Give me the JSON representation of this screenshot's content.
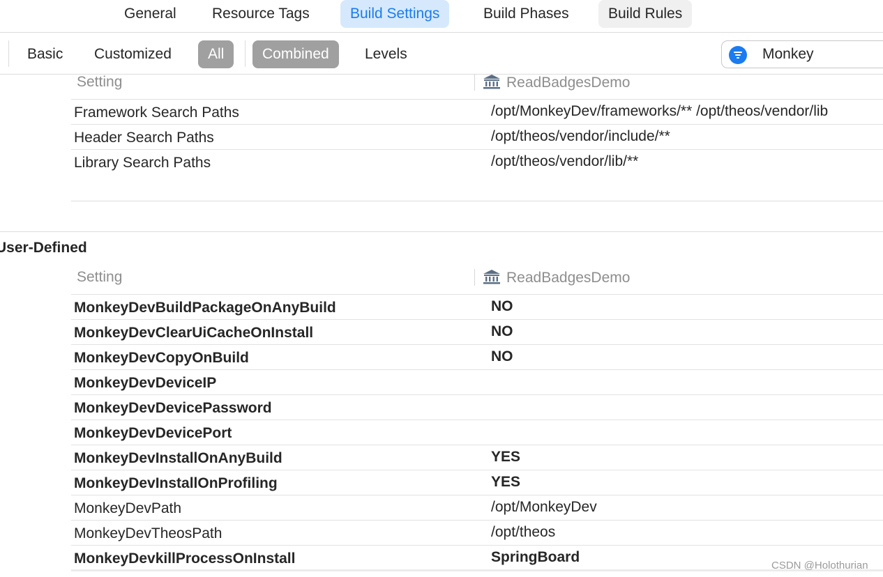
{
  "tabs": [
    "General",
    "Resource Tags",
    "Build Settings",
    "Build Phases",
    "Build Rules"
  ],
  "filter": {
    "basic": "Basic",
    "customized": "Customized",
    "all": "All",
    "combined": "Combined",
    "levels": "Levels"
  },
  "search": {
    "value": "Monkey",
    "icon": "filter-icon"
  },
  "search_paths_section": {
    "col_setting": "Setting",
    "col_target": "ReadBadgesDemo",
    "target_icon": "target-building-icon",
    "rows": [
      {
        "name": "Framework Search Paths",
        "value": "/opt/MonkeyDev/frameworks/** /opt/theos/vendor/lib"
      },
      {
        "name": "Header Search Paths",
        "value": "/opt/theos/vendor/include/**"
      },
      {
        "name": "Library Search Paths",
        "value": "/opt/theos/vendor/lib/**"
      }
    ]
  },
  "user_defined_section": {
    "title": "User-Defined",
    "col_setting": "Setting",
    "col_target": "ReadBadgesDemo",
    "rows": [
      {
        "name": "MonkeyDevBuildPackageOnAnyBuild",
        "value": "NO",
        "bold": true
      },
      {
        "name": "MonkeyDevClearUiCacheOnInstall",
        "value": "NO",
        "bold": true
      },
      {
        "name": "MonkeyDevCopyOnBuild",
        "value": "NO",
        "bold": true
      },
      {
        "name": "MonkeyDevDeviceIP",
        "value": "",
        "bold": true
      },
      {
        "name": "MonkeyDevDevicePassword",
        "value": "",
        "bold": true
      },
      {
        "name": "MonkeyDevDevicePort",
        "value": "",
        "bold": true
      },
      {
        "name": "MonkeyDevInstallOnAnyBuild",
        "value": "YES",
        "bold": true
      },
      {
        "name": "MonkeyDevInstallOnProfiling",
        "value": "YES",
        "bold": true
      },
      {
        "name": "MonkeyDevPath",
        "value": "/opt/MonkeyDev",
        "bold": false
      },
      {
        "name": "MonkeyDevTheosPath",
        "value": "/opt/theos",
        "bold": false
      },
      {
        "name": "MonkeyDevkillProcessOnInstall",
        "value": "SpringBoard",
        "bold": true
      }
    ]
  },
  "watermark": "CSDN @Holothurian"
}
